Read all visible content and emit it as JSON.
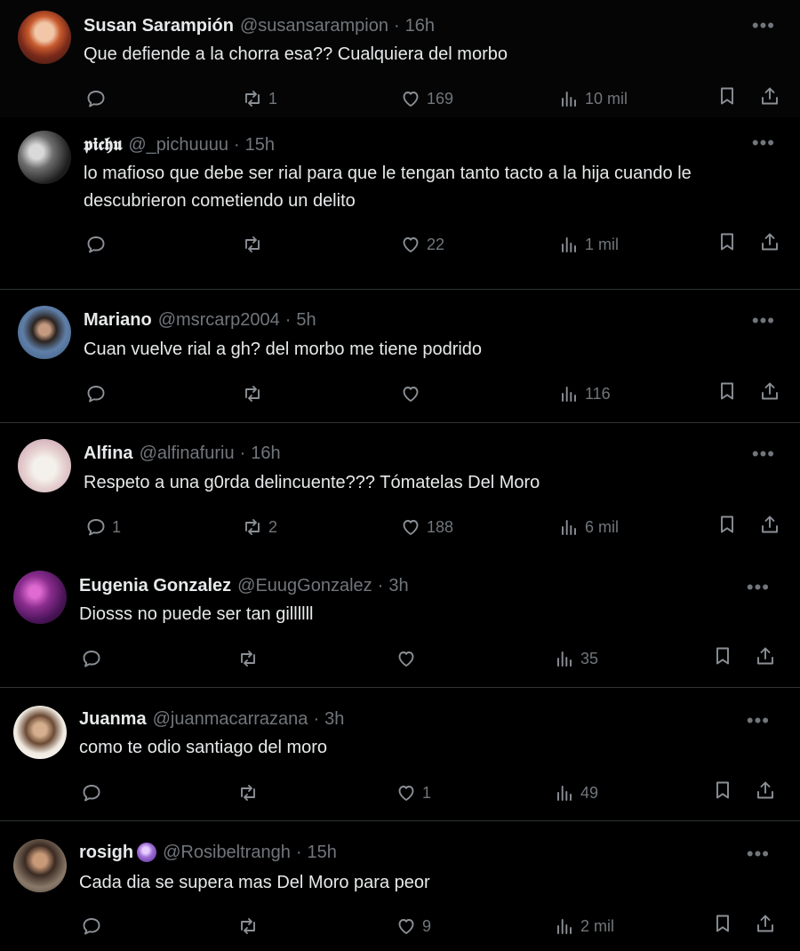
{
  "tweets": [
    {
      "name": "Susan Sarampión",
      "handle": "@susansarampion",
      "time": "16h",
      "text": "Que defiende a la chorra esa?? Cualquiera del morbo",
      "replies": "",
      "retweets": "1",
      "likes": "169",
      "views": "10 mil"
    },
    {
      "name": "𝖕𝖎𝖈𝖍𝖚",
      "handle": "@_pichuuuu",
      "time": "15h",
      "text": "lo mafioso que debe ser rial para que le tengan tanto tacto a la hija cuando le descubrieron cometiendo un delito",
      "replies": "",
      "retweets": "",
      "likes": "22",
      "views": "1 mil"
    },
    {
      "name": "Mariano",
      "handle": "@msrcarp2004",
      "time": "5h",
      "text": "Cuan vuelve rial a gh? del morbo me tiene podrido",
      "replies": "",
      "retweets": "",
      "likes": "",
      "views": "116"
    },
    {
      "name": "Alfina",
      "handle": "@alfinafuriu",
      "time": "16h",
      "text": "Respeto a una g0rda delincuente??? Tómatelas Del Moro",
      "replies": "1",
      "retweets": "2",
      "likes": "188",
      "views": "6 mil"
    },
    {
      "name": "Eugenia Gonzalez",
      "handle": "@EuugGonzalez",
      "time": "3h",
      "text": "Diosss no puede ser tan gillllll",
      "replies": "",
      "retweets": "",
      "likes": "",
      "views": "35"
    },
    {
      "name": "Juanma",
      "handle": "@juanmacarrazana",
      "time": "3h",
      "text": "como te odio santiago del moro",
      "replies": "",
      "retweets": "",
      "likes": "1",
      "views": "49"
    },
    {
      "name": "rosigh",
      "handle": "@Rosibeltrangh",
      "time": "15h",
      "text": "Cada dia se supera mas Del Moro para peor",
      "replies": "",
      "retweets": "",
      "likes": "9",
      "views": "2 mil"
    }
  ],
  "separator": "·",
  "icons": {
    "more": "more-options-icon",
    "reply": "reply-icon",
    "retweet": "retweet-icon",
    "like": "heart-icon",
    "views": "views-icon",
    "bookmark": "bookmark-icon",
    "share": "share-icon",
    "verified_badge": "crystal-ball-emoji-icon"
  },
  "colors": {
    "background": "#000000",
    "text": "#e7e9ea",
    "muted": "#71767b",
    "divider": "#2f3336"
  }
}
